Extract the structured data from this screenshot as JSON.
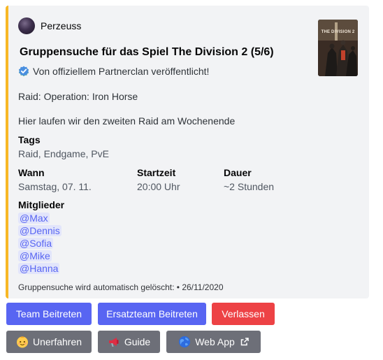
{
  "author": {
    "name": "Perzeuss"
  },
  "embed": {
    "title": "Gruppensuche für das Spiel The Division 2 (5/6)",
    "verified_text": "Von offiziellem Partnerclan veröffentlicht!",
    "raid_line": "Raid: Operation: Iron Horse",
    "description": "Hier laufen wir den zweiten Raid am Wochenende",
    "thumbnail_text": "THE DIVISION 2",
    "accent_color": "#f8b825",
    "fields": {
      "tags": {
        "name": "Tags",
        "value": "Raid, Endgame, PvE"
      },
      "wann": {
        "name": "Wann",
        "value": "Samstag, 07. 11."
      },
      "startzeit": {
        "name": "Startzeit",
        "value": "20:00 Uhr"
      },
      "dauer": {
        "name": "Dauer",
        "value": "~2 Stunden"
      },
      "mitglieder": {
        "name": "Mitglieder",
        "members": [
          "@Max",
          "@Dennis",
          "@Sofia",
          "@Mike",
          "@Hanna"
        ]
      }
    },
    "footer": "Gruppensuche wird automatisch gelöscht: • 26/11/2020"
  },
  "buttons": {
    "join_team": "Team Beitreten",
    "join_reserve": "Ersatzteam Beitreten",
    "leave": "Verlassen",
    "unerfahren": "Unerfahren",
    "guide": "Guide",
    "webapp": "Web App"
  },
  "icons": {
    "unerfahren": "baby-face-icon",
    "guide": "megaphone-icon",
    "webapp": "globe-icon",
    "external": "external-link-icon"
  },
  "colors": {
    "blurple": "#5865f2",
    "red": "#ed4245",
    "grey": "#6d6f78"
  }
}
